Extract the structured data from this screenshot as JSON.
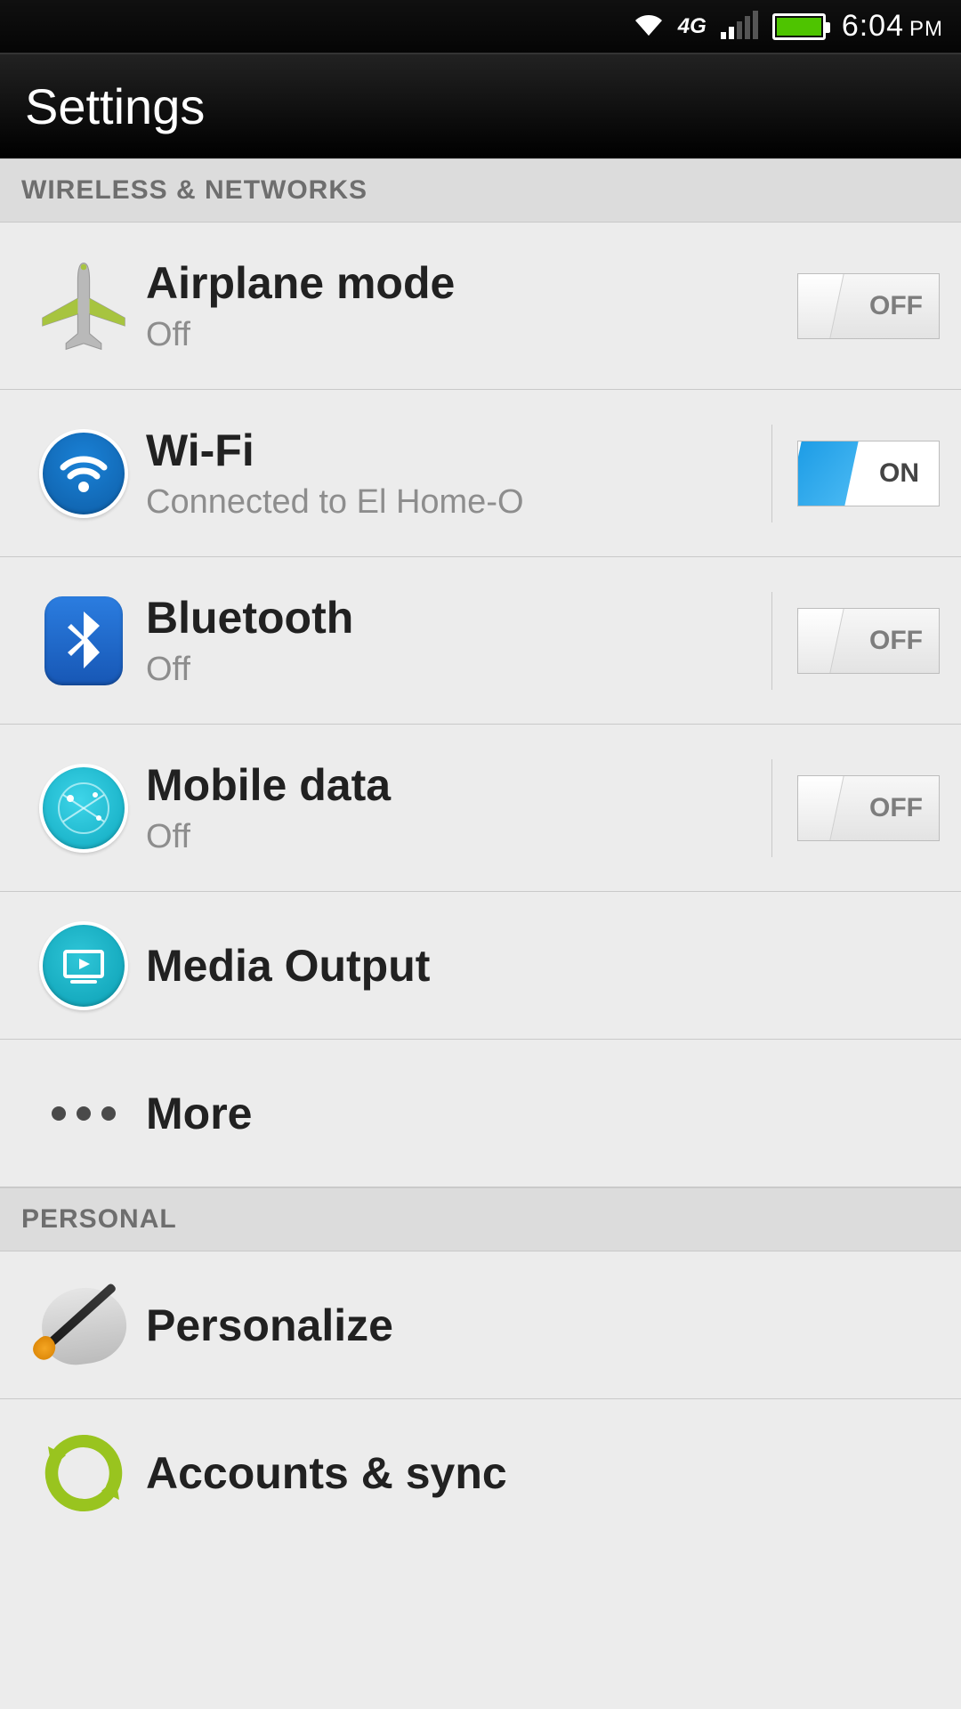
{
  "status": {
    "network_type": "4G",
    "time": "6:04",
    "ampm": "PM"
  },
  "appbar": {
    "title": "Settings"
  },
  "sections": {
    "wireless": {
      "header": "WIRELESS & NETWORKS",
      "airplane": {
        "title": "Airplane mode",
        "subtitle": "Off",
        "toggle": "OFF"
      },
      "wifi": {
        "title": "Wi-Fi",
        "subtitle": "Connected to El Home-O",
        "toggle": "ON"
      },
      "bluetooth": {
        "title": "Bluetooth",
        "subtitle": "Off",
        "toggle": "OFF"
      },
      "mobiledata": {
        "title": "Mobile data",
        "subtitle": "Off",
        "toggle": "OFF"
      },
      "media": {
        "title": "Media Output"
      },
      "more": {
        "title": "More"
      }
    },
    "personal": {
      "header": "PERSONAL",
      "personalize": {
        "title": "Personalize"
      },
      "accounts": {
        "title": "Accounts & sync"
      }
    }
  }
}
